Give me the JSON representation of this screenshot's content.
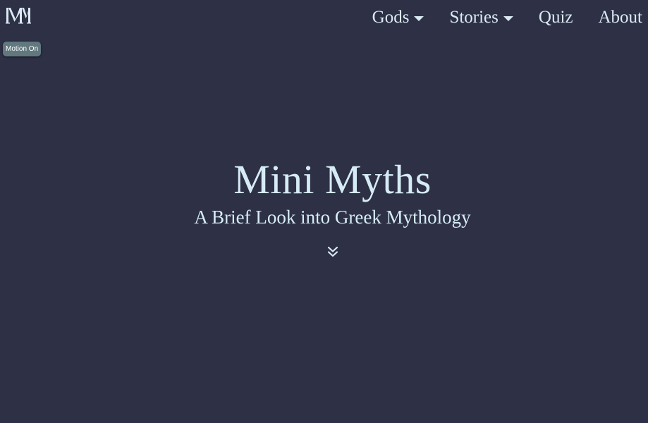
{
  "brand": {
    "logo_text": "MM",
    "logo_icon": "mm-monogram-logo"
  },
  "motion_toggle": {
    "label": "Motion On",
    "state": "on"
  },
  "nav": {
    "items": [
      {
        "label": "Gods",
        "has_dropdown": true
      },
      {
        "label": "Stories",
        "has_dropdown": true
      },
      {
        "label": "Quiz",
        "has_dropdown": false
      },
      {
        "label": "About",
        "has_dropdown": false
      }
    ]
  },
  "hero": {
    "title": "Mini Myths",
    "subtitle": "A Brief Look into Greek Mythology",
    "scroll_icon": "double-chevron-down-icon"
  },
  "colors": {
    "background": "#2e3146",
    "text": "#d6ecf5",
    "toggle_background": "#61787e"
  }
}
